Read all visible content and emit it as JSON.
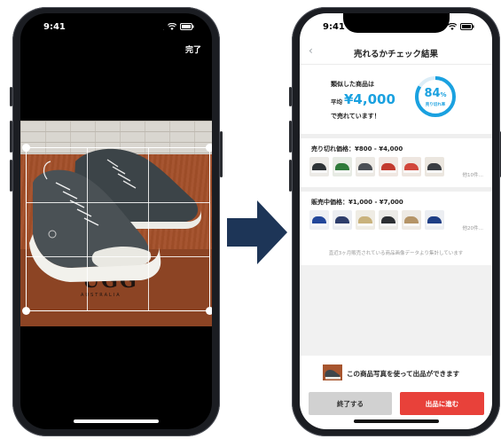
{
  "left_screen": {
    "status_time": "9:41",
    "done_label": "完了",
    "photo_logo_text": "UGG",
    "photo_logo_sub": "AUSTRALIA"
  },
  "right_screen": {
    "status_time": "9:41",
    "title": "売れるかチェック結果",
    "summary": {
      "line1": "類似した商品は",
      "prefix": "平均",
      "price": "¥4,000",
      "line3": "で売れています！",
      "percent_value": "84",
      "percent_symbol": "%",
      "percent_label": "売り切れ率",
      "percent_fraction": 0.84
    },
    "sold_section": {
      "title": "売り切れ価格：¥800 - ¥4,000",
      "more": "他10件…"
    },
    "selling_section": {
      "title": "販売中価格：¥1,000 - ¥7,000",
      "more": "他20件…"
    },
    "note": "直近3ヶ月販売されている商品画像データより集計しています",
    "cta_text": "この商品写真を使って出品ができます",
    "end_button": "終了する",
    "proceed_button": "出品に進む"
  },
  "colors": {
    "accent_blue": "#1aa1e0",
    "cta_red": "#e8413a",
    "arrow_navy": "#1d3557"
  }
}
